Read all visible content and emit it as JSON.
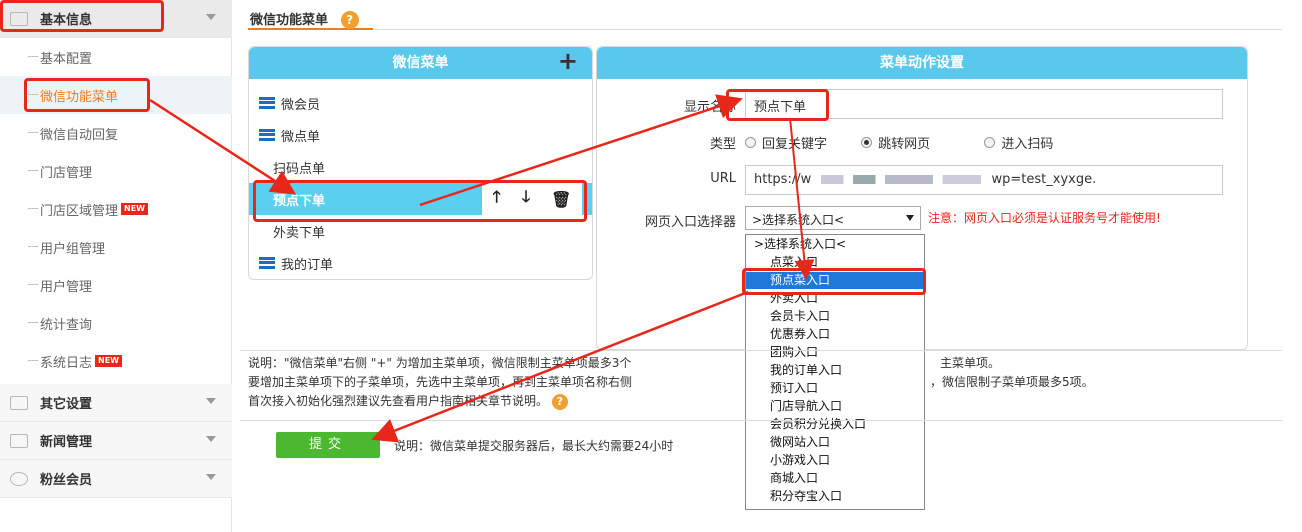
{
  "sidebar": {
    "groups": [
      {
        "label": "基本信息"
      },
      {
        "label": "其它设置"
      },
      {
        "label": "新闻管理"
      },
      {
        "label": "粉丝会员"
      }
    ],
    "items": [
      {
        "label": "基本配置",
        "badge": ""
      },
      {
        "label": "微信功能菜单",
        "badge": ""
      },
      {
        "label": "微信自动回复",
        "badge": ""
      },
      {
        "label": "门店管理",
        "badge": ""
      },
      {
        "label": "门店区域管理",
        "badge": "NEW"
      },
      {
        "label": "用户组管理",
        "badge": ""
      },
      {
        "label": "用户管理",
        "badge": ""
      },
      {
        "label": "统计查询",
        "badge": ""
      },
      {
        "label": "系统日志",
        "badge": "NEW"
      }
    ]
  },
  "tab": {
    "label": "微信功能菜单",
    "help": "?"
  },
  "menu_panel": {
    "title": "微信菜单",
    "add": "+",
    "rows": [
      {
        "label": "微会员"
      },
      {
        "label": "微点单"
      },
      {
        "label": "扫码点单"
      },
      {
        "label": "预点下单"
      },
      {
        "label": "外卖下单"
      },
      {
        "label": "我的订单"
      }
    ],
    "actions": {
      "up": "🡑",
      "down": "🡓",
      "delete": "🗑"
    }
  },
  "action_panel": {
    "title": "菜单动作设置",
    "name_label": "显示名称",
    "name_value": "预点下单",
    "type_label": "类型",
    "types": [
      "回复关键字",
      "跳转网页",
      "进入扫码"
    ],
    "url_label": "URL",
    "url_value": "https://w",
    "url_tail": "wp=test_xyxge.",
    "entry_label": "网页入口选择器",
    "entry_selected": ">选择系统入口<",
    "warning": "注意：网页入口必须是认证服务号才能使用!"
  },
  "dropdown": [
    ">选择系统入口<",
    "点菜入口",
    "预点菜入口",
    "外卖入口",
    "会员卡入口",
    "优惠券入口",
    "团购入口",
    "我的订单入口",
    "预订入口",
    "门店导航入口",
    "会员积分兑换入口",
    "微网站入口",
    "小游戏入口",
    "商城入口",
    "积分夺宝入口"
  ],
  "notes": [
    "说明：\"微信菜单\"右侧 \"+\" 为增加主菜单项，微信限制主菜单项最多3个",
    "要增加主菜单项下的子菜单项，先选中主菜单项，再到主菜单项名称右侧",
    "首次接入初始化强烈建议先查看用户指南相关章节说明。"
  ],
  "notes_tail": [
    "主菜单项。",
    "，微信限制子菜单项最多5项。"
  ],
  "submit": {
    "label": "提交",
    "note": "说明：微信菜单提交服务器后，最长大约需要24小时"
  }
}
